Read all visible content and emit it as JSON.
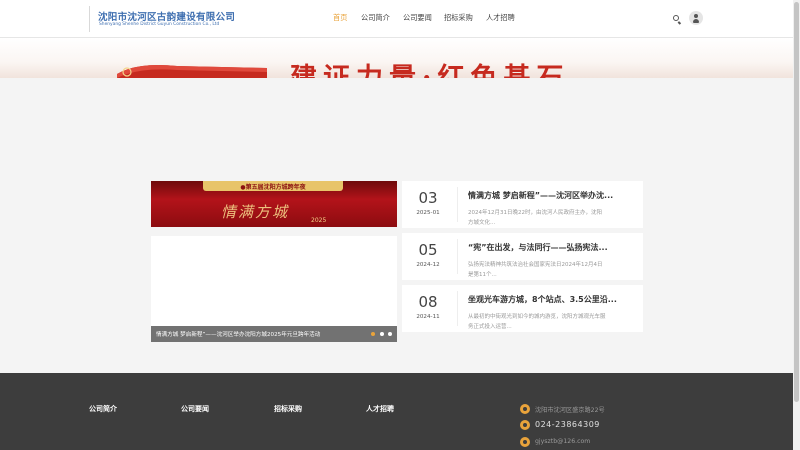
{
  "header": {
    "company_cn": "沈阳市沈河区古韵建设有限公司",
    "company_en": "Shenyang Shenhe District Guyun Construction Co., Ltd",
    "nav": [
      "首页",
      "公司简介",
      "公司要闻",
      "招标采购",
      "人才招聘"
    ],
    "active_nav": "首页",
    "icons": [
      "search-icon",
      "user-icon"
    ]
  },
  "banner": {
    "slogan": "建证力量·红色基石"
  },
  "slider": {
    "image_title": "●第五届沈阳方城跨年夜",
    "image_art": "情满方城",
    "image_year": "2025",
    "caption": "情满方城 梦启新程”——沈河区举办沈阳方城2025年元旦跨年活动",
    "active_dot": 0
  },
  "news": [
    {
      "day": "03",
      "month": "2025-01",
      "title": "情满方城 梦启新程”——沈河区举办沈...",
      "desc": "2024年12月31日晚22时，由沈河人民政府主办，沈阳方城文化..."
    },
    {
      "day": "05",
      "month": "2024-12",
      "title": "“宪”在出发，与法同行——弘扬宪法...",
      "desc": "弘扬宪法精神共筑法治社会国家宪法日2024年12月4日是第11个..."
    },
    {
      "day": "08",
      "month": "2024-11",
      "title": "坐观光车游方城，8个站点、3.5公里沿...",
      "desc": "从最初的中街观光到如今的城内游览，沈阳方城观光车服务正式投入运营..."
    }
  ],
  "footer": {
    "links": [
      "公司简介",
      "公司要闻",
      "招标采购",
      "人才招聘"
    ],
    "address": "沈阳市沈河区盛京路22号",
    "phone": "024-23864309",
    "email": "gjysztb@126.com"
  },
  "colors": {
    "accent": "#e9a33b",
    "brand": "#3f6fb0",
    "banner_red": "#c62a1f",
    "footer_bg": "#3d3d3d"
  }
}
